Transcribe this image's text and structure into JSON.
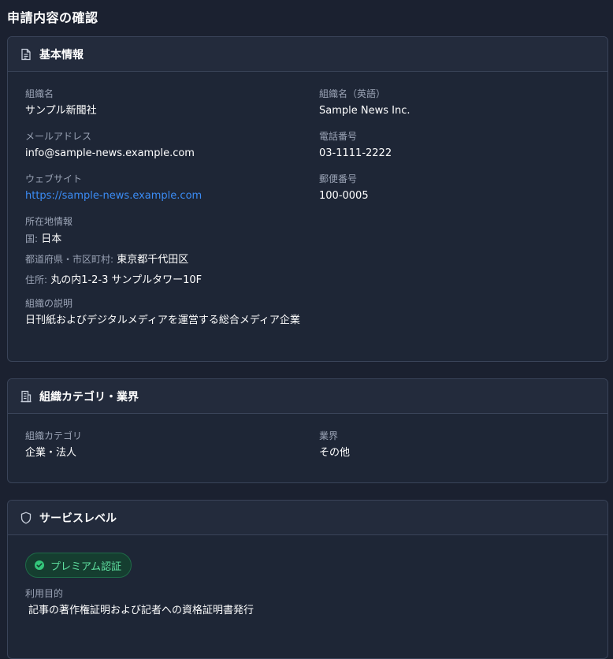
{
  "page": {
    "title": "申請内容の確認"
  },
  "basic_info": {
    "title": "基本情報",
    "icon": "document-icon",
    "org_name_label": "組織名",
    "org_name_value": "サンプル新聞社",
    "org_name_en_label": "組織名（英語）",
    "org_name_en_value": "Sample News Inc.",
    "email_label": "メールアドレス",
    "email_value": "info@sample-news.example.com",
    "phone_label": "電話番号",
    "phone_value": "03-1111-2222",
    "website_label": "ウェブサイト",
    "website_value": "https://sample-news.example.com",
    "postal_label": "郵便番号",
    "postal_value": "100-0005",
    "location_label": "所在地情報",
    "country_prefix": "国:",
    "country_value": "日本",
    "pref_prefix": "都道府県・市区町村:",
    "pref_value": "東京都千代田区",
    "address_prefix": "住所:",
    "address_value": "丸の内1-2-3 サンプルタワー10F",
    "description_label": "組織の説明",
    "description_value": "日刊紙およびデジタルメディアを運営する総合メディア企業"
  },
  "category": {
    "title": "組織カテゴリ・業界",
    "icon": "building-icon",
    "category_label": "組織カテゴリ",
    "category_value": "企業・法人",
    "industry_label": "業界",
    "industry_value": "その他"
  },
  "service": {
    "title": "サービスレベル",
    "icon": "shield-icon",
    "badge_label": "プレミアム認証",
    "badge_icon": "check-circle-icon",
    "purpose_label": "利用目的",
    "purpose_value": "記事の著作権証明および記者への資格証明書発行"
  },
  "colors": {
    "background": "#1b2130",
    "card": "#1e2636",
    "border": "#3a4459",
    "link": "#3b8cf5",
    "badge_text": "#5fe0a0",
    "badge_bg": "#153e30"
  }
}
